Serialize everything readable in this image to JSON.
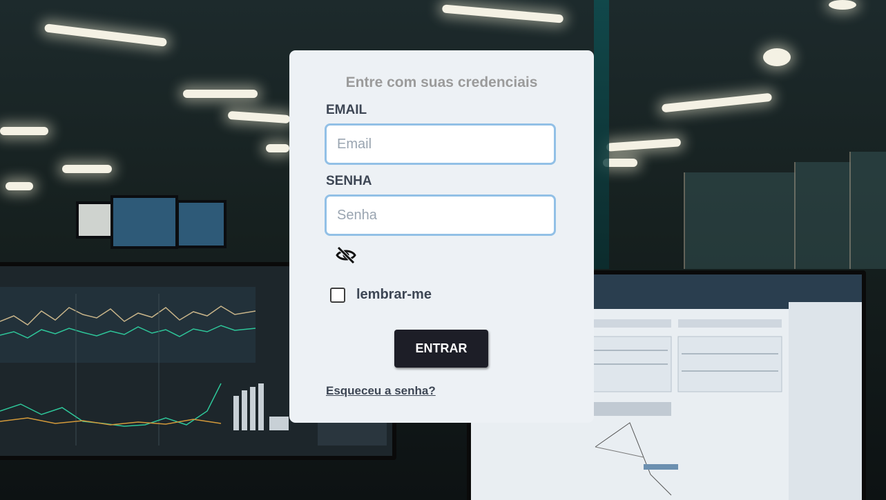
{
  "login": {
    "title": "Entre com suas credenciais",
    "email": {
      "label": "EMAIL",
      "placeholder": "Email",
      "value": ""
    },
    "password": {
      "label": "SENHA",
      "placeholder": "Senha",
      "value": ""
    },
    "show_password_icon": "eye-slash-icon",
    "remember_me": {
      "label": "lembrar-me",
      "checked": false
    },
    "submit_label": "ENTRAR",
    "forgot_password_label": "Esqueceu a senha?"
  },
  "colors": {
    "card_background": "#edf1f5",
    "input_border": "#92c0e6",
    "button_background": "#1d1e27",
    "label_text": "#3d4654",
    "title_text": "#9b9b9b"
  }
}
